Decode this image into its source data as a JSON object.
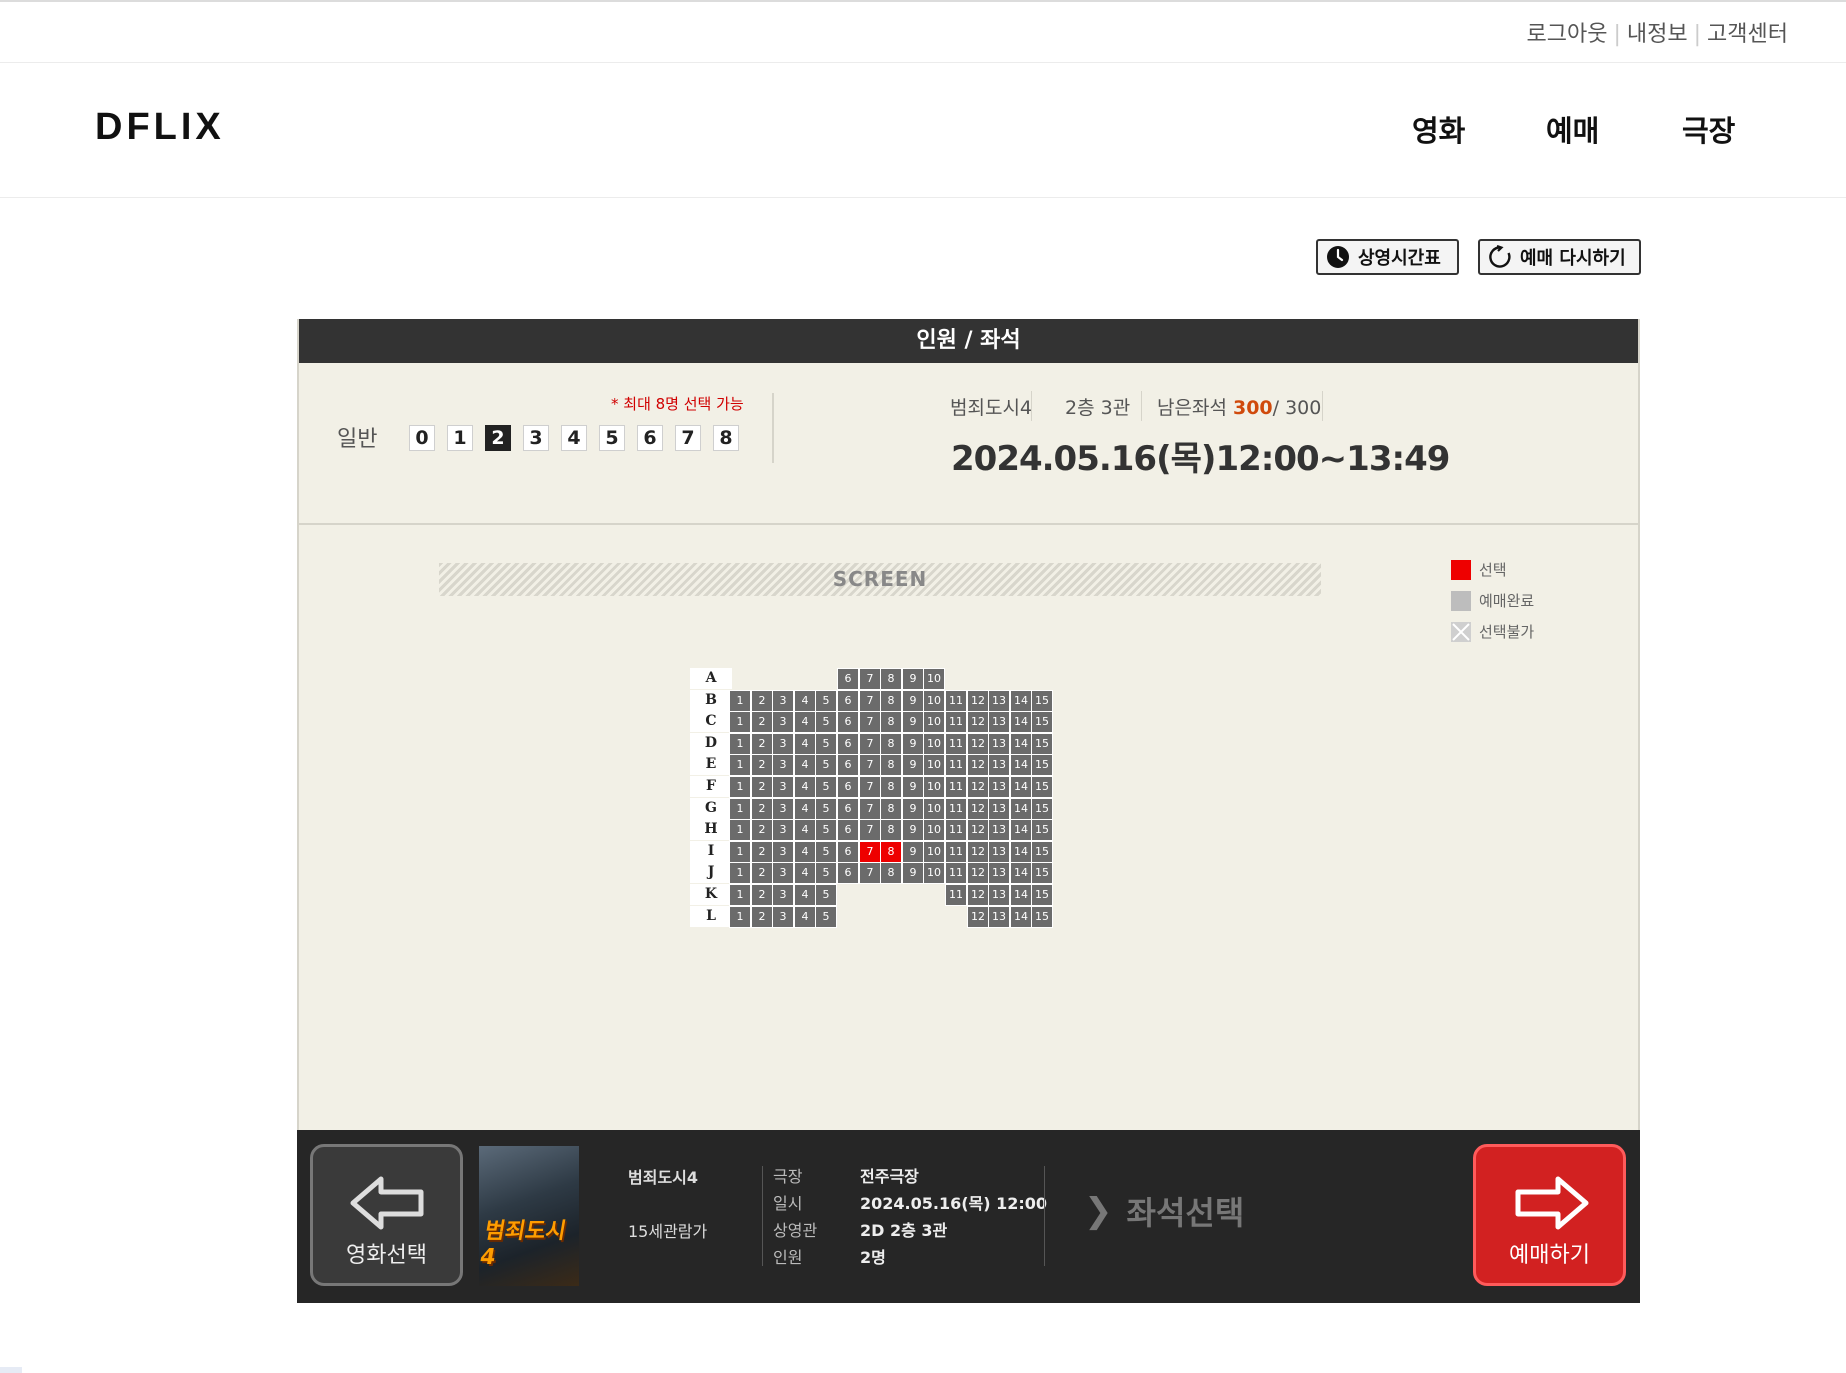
{
  "top_links": {
    "logout": "로그아웃",
    "myinfo": "내정보",
    "support": "고객센터",
    "sep": "|"
  },
  "header": {
    "logo": "DFLIX",
    "nav": [
      "영화",
      "예매",
      "극장"
    ]
  },
  "actions": {
    "schedule": "상영시간표",
    "restart": "예매 다시하기"
  },
  "panel": {
    "title": "인원 / 좌석",
    "max_note": "* 최대 8명 선택 가능",
    "audience_label": "일반",
    "counts": [
      "0",
      "1",
      "2",
      "3",
      "4",
      "5",
      "6",
      "7",
      "8"
    ],
    "selected_count": "2",
    "movie": "범죄도시4",
    "hall": "2층 3관",
    "remaining_label": "남은좌석",
    "remaining": "300",
    "total": "/ 300",
    "datetime": "2024.05.16(목)12:00~13:49",
    "screen_label": "SCREEN",
    "legend": {
      "selected": "선택",
      "reserved": "예매완료",
      "unavailable": "선택불가"
    },
    "colors": {
      "selected": "#ee0000",
      "available": "#6b6b6b",
      "reserved": "#bdbdbd",
      "header": "#333333"
    }
  },
  "seatmap": {
    "rows": [
      {
        "label": "A",
        "seats": [
          "6",
          "7",
          "8",
          "9",
          "10"
        ]
      },
      {
        "label": "B",
        "seats": [
          "1",
          "2",
          "3",
          "4",
          "5",
          "6",
          "7",
          "8",
          "9",
          "10",
          "11",
          "12",
          "13",
          "14",
          "15"
        ]
      },
      {
        "label": "C",
        "seats": [
          "1",
          "2",
          "3",
          "4",
          "5",
          "6",
          "7",
          "8",
          "9",
          "10",
          "11",
          "12",
          "13",
          "14",
          "15"
        ]
      },
      {
        "label": "D",
        "seats": [
          "1",
          "2",
          "3",
          "4",
          "5",
          "6",
          "7",
          "8",
          "9",
          "10",
          "11",
          "12",
          "13",
          "14",
          "15"
        ]
      },
      {
        "label": "E",
        "seats": [
          "1",
          "2",
          "3",
          "4",
          "5",
          "6",
          "7",
          "8",
          "9",
          "10",
          "11",
          "12",
          "13",
          "14",
          "15"
        ]
      },
      {
        "label": "F",
        "seats": [
          "1",
          "2",
          "3",
          "4",
          "5",
          "6",
          "7",
          "8",
          "9",
          "10",
          "11",
          "12",
          "13",
          "14",
          "15"
        ]
      },
      {
        "label": "G",
        "seats": [
          "1",
          "2",
          "3",
          "4",
          "5",
          "6",
          "7",
          "8",
          "9",
          "10",
          "11",
          "12",
          "13",
          "14",
          "15"
        ]
      },
      {
        "label": "H",
        "seats": [
          "1",
          "2",
          "3",
          "4",
          "5",
          "6",
          "7",
          "8",
          "9",
          "10",
          "11",
          "12",
          "13",
          "14",
          "15"
        ]
      },
      {
        "label": "I",
        "seats": [
          "1",
          "2",
          "3",
          "4",
          "5",
          "6",
          "7",
          "8",
          "9",
          "10",
          "11",
          "12",
          "13",
          "14",
          "15"
        ],
        "selected": [
          "7",
          "8"
        ]
      },
      {
        "label": "J",
        "seats": [
          "1",
          "2",
          "3",
          "4",
          "5",
          "6",
          "7",
          "8",
          "9",
          "10",
          "11",
          "12",
          "13",
          "14",
          "15"
        ]
      },
      {
        "label": "K",
        "seats": [
          "1",
          "2",
          "3",
          "4",
          "5",
          "11",
          "12",
          "13",
          "14",
          "15"
        ]
      },
      {
        "label": "L",
        "seats": [
          "1",
          "2",
          "3",
          "4",
          "5",
          "12",
          "13",
          "14",
          "15"
        ]
      }
    ]
  },
  "footer": {
    "prev_label": "영화선택",
    "next_label": "예매하기",
    "poster_title": "범죄도시4",
    "movie_title": "범죄도시4",
    "rating": "15세관람가",
    "details": [
      {
        "key": "극장",
        "value": "전주극장"
      },
      {
        "key": "일시",
        "value": "2024.05.16(목) 12:00"
      },
      {
        "key": "상영관",
        "value": "2D 2층 3관"
      },
      {
        "key": "인원",
        "value": "2명"
      }
    ],
    "step": "좌석선택"
  }
}
